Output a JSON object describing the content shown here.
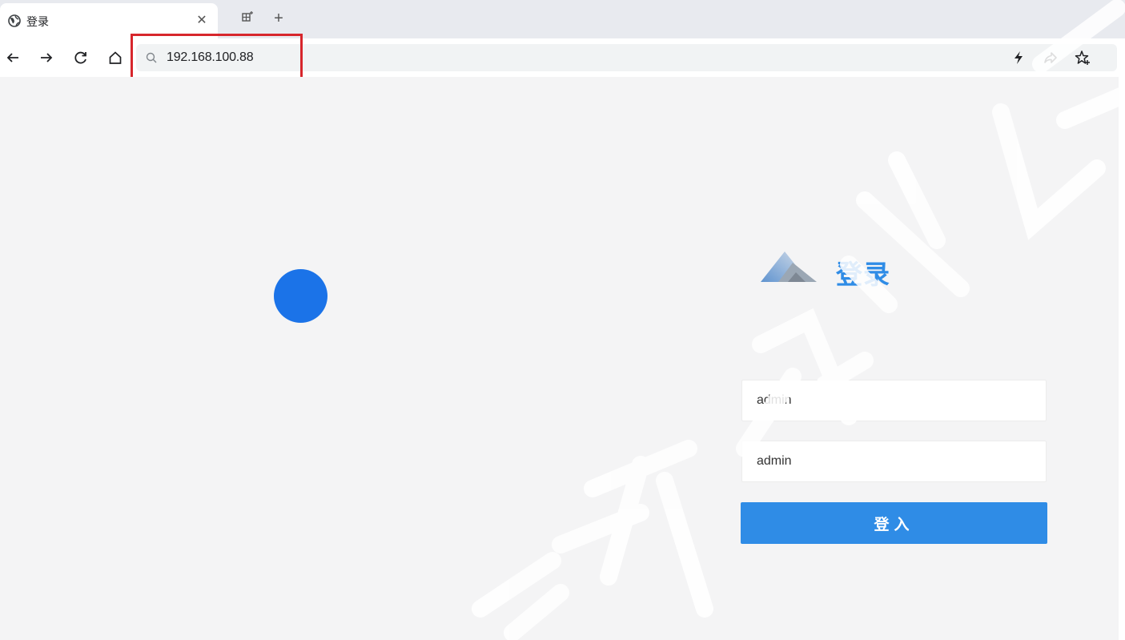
{
  "browser": {
    "tab": {
      "title": "登录"
    },
    "address_bar": {
      "url": "192.168.100.88"
    },
    "colors": {
      "highlight": "#d7262c"
    }
  },
  "login": {
    "title": "登录",
    "username_value": "admin",
    "password_value": "admin",
    "submit_label": "登入",
    "colors": {
      "accent": "#2f8ce6",
      "spinner": "#1b73e8",
      "background": "#f4f4f5"
    }
  },
  "icons": {
    "tab": [
      "globe-icon",
      "close-icon",
      "grid-icon",
      "plus-icon"
    ],
    "toolbar": [
      "back-arrow-icon",
      "forward-arrow-icon",
      "reload-icon",
      "home-icon",
      "search-icon",
      "lightning-icon",
      "share-icon",
      "star-add-icon"
    ]
  }
}
